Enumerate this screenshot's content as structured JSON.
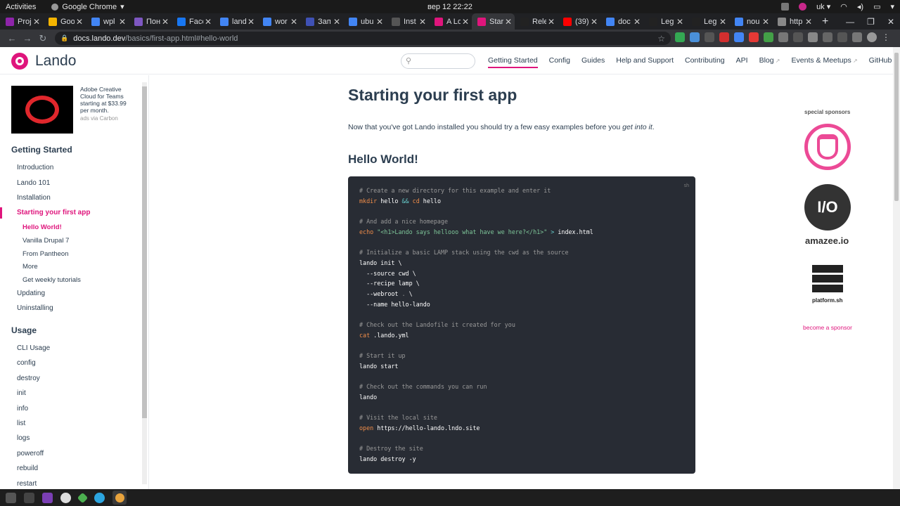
{
  "system": {
    "activities": "Activities",
    "app_name": "Google Chrome",
    "clock": "вер 12  22:22",
    "keyboard_layout": "uk"
  },
  "tabs": [
    {
      "label": "Proj",
      "color": "#8e24aa"
    },
    {
      "label": "Goo",
      "color": "#f4b400"
    },
    {
      "label": "wpl",
      "color": "#4285f4"
    },
    {
      "label": "Пон",
      "color": "#7e57c2"
    },
    {
      "label": "Face",
      "color": "#1877f2"
    },
    {
      "label": "land",
      "color": "#4285f4"
    },
    {
      "label": "wor",
      "color": "#4285f4"
    },
    {
      "label": "Зап",
      "color": "#3f51b5"
    },
    {
      "label": "ubu",
      "color": "#4285f4"
    },
    {
      "label": "Inst",
      "color": "#555555"
    },
    {
      "label": "A Lo",
      "color": "#df157c"
    },
    {
      "label": "Star",
      "color": "#df157c",
      "active": true
    },
    {
      "label": "Rele",
      "color": "#222222"
    },
    {
      "label": "(39)",
      "color": "#ff0000"
    },
    {
      "label": "doc",
      "color": "#4285f4"
    },
    {
      "label": "Leg",
      "color": "#222222"
    },
    {
      "label": "Leg",
      "color": "#222222"
    },
    {
      "label": "nou",
      "color": "#4285f4"
    },
    {
      "label": "http",
      "color": "#888888"
    }
  ],
  "address_bar": {
    "host": "docs.lando.dev",
    "path": "/basics/first-app.html#hello-world"
  },
  "header": {
    "logo_text": "Lando",
    "nav": [
      {
        "label": "Getting Started",
        "current": true
      },
      {
        "label": "Config"
      },
      {
        "label": "Guides"
      },
      {
        "label": "Help and Support"
      },
      {
        "label": "Contributing"
      },
      {
        "label": "API"
      },
      {
        "label": "Blog",
        "external": true
      },
      {
        "label": "Events & Meetups",
        "external": true
      },
      {
        "label": "GitHub",
        "external": true
      }
    ]
  },
  "ad": {
    "text": "Adobe Creative Cloud for Teams starting at $33.99 per month.",
    "via": "ads via Carbon"
  },
  "sidebar": {
    "getting_started_heading": "Getting Started",
    "getting_started_items": [
      "Introduction",
      "Lando 101",
      "Installation",
      "Starting your first app"
    ],
    "sub_items": [
      "Hello World!",
      "Vanilla Drupal 7",
      "From Pantheon",
      "More",
      "Get weekly tutorials"
    ],
    "after_items": [
      "Updating",
      "Uninstalling"
    ],
    "usage_heading": "Usage",
    "usage_items": [
      "CLI Usage",
      "config",
      "destroy",
      "init",
      "info",
      "list",
      "logs",
      "poweroff",
      "rebuild",
      "restart"
    ]
  },
  "content": {
    "title": "Starting your first app",
    "intro_before": "Now that you've got Lando installed you should try a few easy examples before you ",
    "intro_em": "get into it",
    "intro_after": ".",
    "section_title": "Hello World!",
    "code_lang": "sh",
    "code_lines": [
      [
        {
          "t": "# Create a new directory for this example and enter it",
          "c": "cmt"
        }
      ],
      [
        {
          "t": "mkdir",
          "c": "kw"
        },
        {
          "t": " hello "
        },
        {
          "t": "&&",
          "c": "op"
        },
        {
          "t": " "
        },
        {
          "t": "cd",
          "c": "kw"
        },
        {
          "t": " hello"
        }
      ],
      [],
      [
        {
          "t": "# And add a nice homepage",
          "c": "cmt"
        }
      ],
      [
        {
          "t": "echo",
          "c": "kw"
        },
        {
          "t": " "
        },
        {
          "t": "\"<h1>Lando says hellooo what have we here?</h1>\"",
          "c": "str"
        },
        {
          "t": " "
        },
        {
          "t": ">",
          "c": "op"
        },
        {
          "t": " index.html"
        }
      ],
      [],
      [
        {
          "t": "# Initialize a basic LAMP stack using the cwd as the source",
          "c": "cmt"
        }
      ],
      [
        {
          "t": "lando init \\"
        }
      ],
      [
        {
          "t": "  --source cwd \\"
        }
      ],
      [
        {
          "t": "  --recipe lamp \\"
        }
      ],
      [
        {
          "t": "  --webroot "
        },
        {
          "t": ".",
          "c": "cmt"
        },
        {
          "t": " \\"
        }
      ],
      [
        {
          "t": "  --name hello-lando"
        }
      ],
      [],
      [
        {
          "t": "# Check out the Landofile it created for you",
          "c": "cmt"
        }
      ],
      [
        {
          "t": "cat",
          "c": "kw"
        },
        {
          "t": " .lando.yml"
        }
      ],
      [],
      [
        {
          "t": "# Start it up",
          "c": "cmt"
        }
      ],
      [
        {
          "t": "lando start"
        }
      ],
      [],
      [
        {
          "t": "# Check out the commands you can run",
          "c": "cmt"
        }
      ],
      [
        {
          "t": "lando"
        }
      ],
      [],
      [
        {
          "t": "# Visit the local site",
          "c": "cmt"
        }
      ],
      [
        {
          "t": "open",
          "c": "kw"
        },
        {
          "t": " https://hello-lando.lndo.site"
        }
      ],
      [],
      [
        {
          "t": "# Destroy the site",
          "c": "cmt"
        }
      ],
      [
        {
          "t": "lando destroy -y"
        }
      ]
    ]
  },
  "sponsors": {
    "title": "special sponsors",
    "amazee_mark": "I/O",
    "amazee_label": "amazee.io",
    "platform_label": "platform.sh",
    "become_link": "become a sponsor"
  },
  "colors": {
    "brand": "#df157c",
    "code_bg": "#282c34",
    "text": "#2c3e50"
  }
}
